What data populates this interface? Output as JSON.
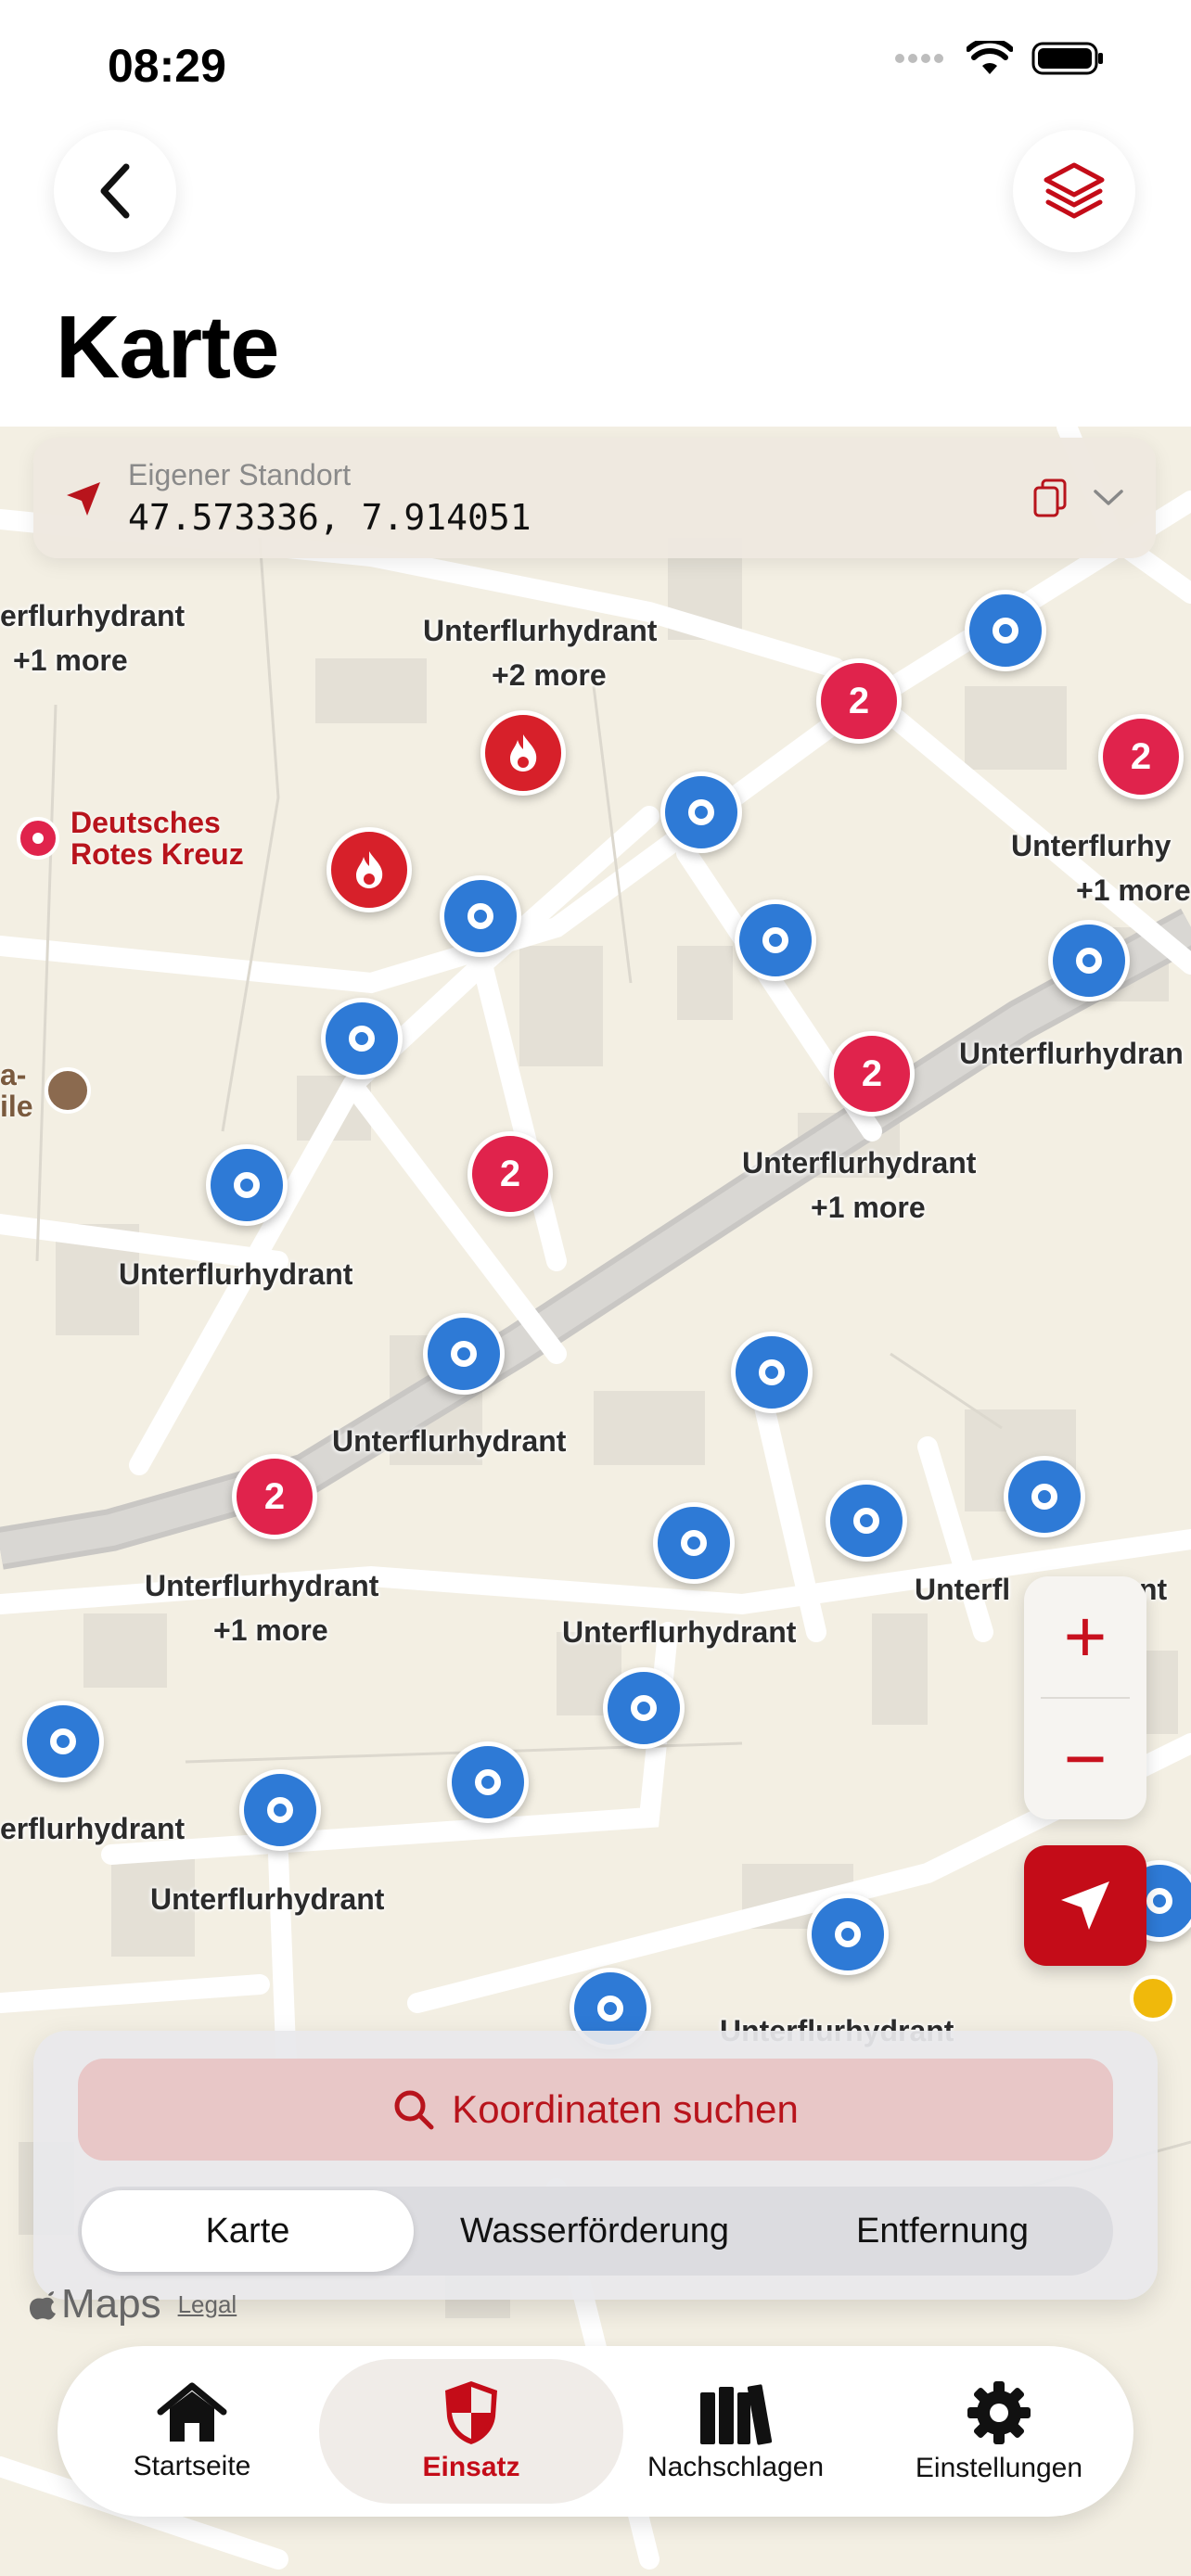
{
  "status_bar": {
    "time": "08:29"
  },
  "nav": {
    "title": "Karte",
    "back_icon": "chevron-left-icon",
    "layers_icon": "layers-icon"
  },
  "location": {
    "label": "Eigener Standort",
    "coordinates": "47.573336, 7.914051",
    "copy_icon": "copy-icon",
    "expand_icon": "chevron-down-icon"
  },
  "map": {
    "labels": [
      {
        "text": "erflurhydrant"
      },
      {
        "text": "+1 more"
      },
      {
        "text": "Unterflurhydrant"
      },
      {
        "text": "+2 more"
      },
      {
        "text": "Unterflurhy"
      },
      {
        "text": "+1 more"
      },
      {
        "text": "Unterflurhydran"
      },
      {
        "text": "Unterflurhydrant"
      },
      {
        "text": "+1 more"
      },
      {
        "text": "Unterflurhydrant"
      },
      {
        "text": "Unterflurhydrant"
      },
      {
        "text": "Unterflurhydrant"
      },
      {
        "text": "+1 more"
      },
      {
        "text": "Unterflurhydrant"
      },
      {
        "text": "Unterfl"
      },
      {
        "text": "nt"
      },
      {
        "text": "erflurhydrant"
      },
      {
        "text": "Unterflurhydrant"
      },
      {
        "text": "Unterflurhydrant"
      }
    ],
    "poi": {
      "name_line1": "Deutsches",
      "name_line2": "Rotes Kreuz",
      "partial_line1": "a-",
      "partial_line2": "ile"
    },
    "cluster_count": "2",
    "attribution": {
      "brand": "Maps",
      "legal": "Legal"
    }
  },
  "zoom": {
    "in": "+",
    "out": "−"
  },
  "panel": {
    "search_label": "Koordinaten suchen",
    "segments": [
      {
        "label": "Karte",
        "active": true
      },
      {
        "label": "Wasserförderung",
        "active": false
      },
      {
        "label": "Entfernung",
        "active": false
      }
    ]
  },
  "tabs": [
    {
      "label": "Startseite",
      "icon": "house-icon",
      "active": false
    },
    {
      "label": "Einsatz",
      "icon": "shield-icon",
      "active": true
    },
    {
      "label": "Nachschlagen",
      "icon": "books-icon",
      "active": false
    },
    {
      "label": "Einstellungen",
      "icon": "gear-icon",
      "active": false
    }
  ],
  "colors": {
    "accent": "#c40c18",
    "hydrant_blue": "#2e7ad6",
    "cluster_red": "#e0234c",
    "map_bg": "#f3efe3"
  }
}
